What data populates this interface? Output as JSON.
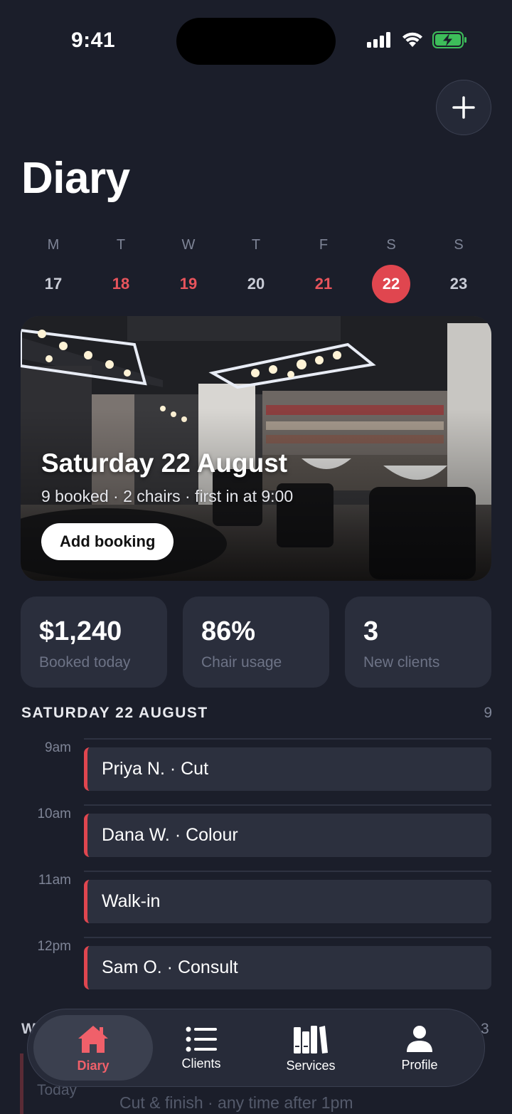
{
  "status_bar": {
    "time": "9:41"
  },
  "header": {
    "title": "Diary",
    "add_icon": "plus-icon"
  },
  "week": {
    "days": [
      {
        "letter": "M",
        "num": "17",
        "state": "normal"
      },
      {
        "letter": "T",
        "num": "18",
        "state": "red"
      },
      {
        "letter": "W",
        "num": "19",
        "state": "red"
      },
      {
        "letter": "T",
        "num": "20",
        "state": "normal"
      },
      {
        "letter": "F",
        "num": "21",
        "state": "red"
      },
      {
        "letter": "S",
        "num": "22",
        "state": "selected"
      },
      {
        "letter": "S",
        "num": "23",
        "state": "normal"
      }
    ],
    "accent_color": "#e0464f"
  },
  "hero": {
    "title": "Saturday 22 August",
    "subtitle": "9 booked · 2 chairs · first in at 9:00",
    "button_label": "Add booking"
  },
  "stats": [
    {
      "value": "$1,240",
      "label": "Booked today"
    },
    {
      "value": "86%",
      "label": "Chair usage"
    },
    {
      "value": "3",
      "label": "New clients"
    }
  ],
  "schedule": {
    "title": "SATURDAY 22 AUGUST",
    "count": "9",
    "slots": [
      {
        "time": "9am",
        "appointment": "Priya N. · Cut"
      },
      {
        "time": "10am",
        "appointment": "Dana W. · Colour"
      },
      {
        "time": "11am",
        "appointment": "Walk-in"
      },
      {
        "time": "12pm",
        "appointment": "Sam O. · Consult"
      }
    ]
  },
  "below_fold": {
    "section_initial": "W",
    "section_count_partial": "3",
    "row_time": "Today",
    "row_text": "Cut & finish · any time after 1pm"
  },
  "tabbar": {
    "tabs": [
      {
        "label": "Diary",
        "icon": "house-icon",
        "active": true
      },
      {
        "label": "Clients",
        "icon": "list-icon",
        "active": false
      },
      {
        "label": "Services",
        "icon": "books-icon",
        "active": false
      },
      {
        "label": "Profile",
        "icon": "person-icon",
        "active": false
      }
    ]
  }
}
